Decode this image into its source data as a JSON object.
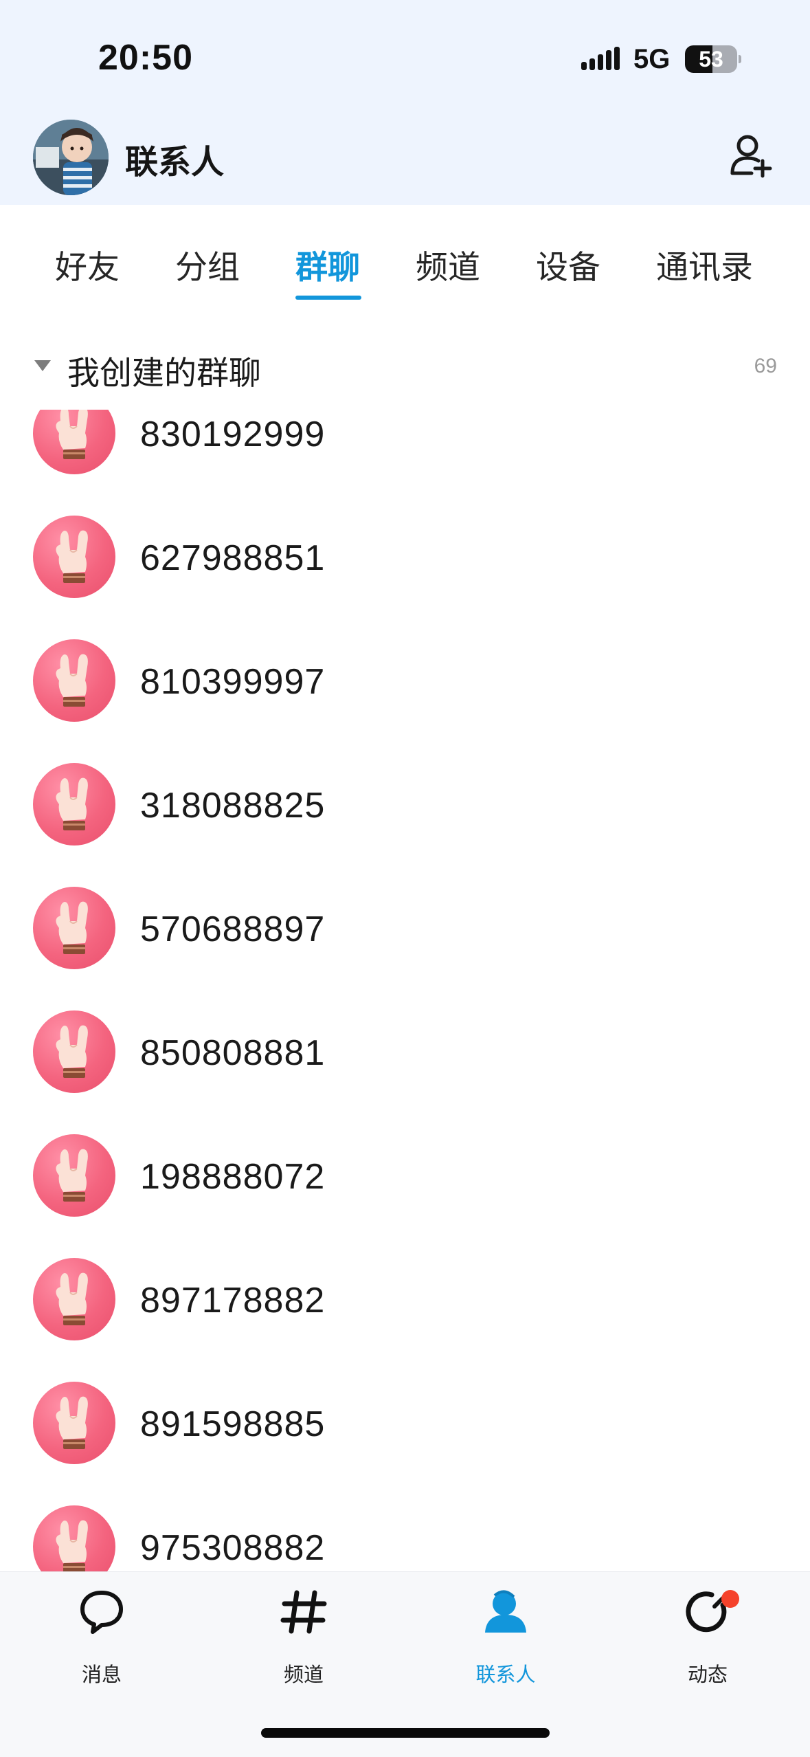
{
  "status_bar": {
    "time": "20:50",
    "network": "5G",
    "battery_level": "53",
    "battery_fraction": 0.53
  },
  "header": {
    "title": "联系人",
    "add_contact_icon": "person-add-icon",
    "avatar_icon": "user-avatar"
  },
  "tabs": [
    {
      "label": "好友"
    },
    {
      "label": "分组"
    },
    {
      "label": "群聊"
    },
    {
      "label": "频道"
    },
    {
      "label": "设备"
    },
    {
      "label": "通讯录"
    }
  ],
  "active_tab": "群聊",
  "section": {
    "title": "我创建的群聊",
    "count": "69",
    "caret_icon": "caret-down-icon"
  },
  "groups": [
    {
      "name": "830192999"
    },
    {
      "name": "627988851"
    },
    {
      "name": "810399997"
    },
    {
      "name": "318088825"
    },
    {
      "name": "570688897"
    },
    {
      "name": "850808881"
    },
    {
      "name": "198888072"
    },
    {
      "name": "897178882"
    },
    {
      "name": "891598885"
    },
    {
      "name": "975308882"
    }
  ],
  "bottom_nav": [
    {
      "label": "消息",
      "icon": "message-bubble-icon"
    },
    {
      "label": "频道",
      "icon": "hash-icon"
    },
    {
      "label": "联系人",
      "icon": "contacts-person-icon"
    },
    {
      "label": "动态",
      "icon": "dynamic-refresh-icon"
    }
  ],
  "colors": {
    "accent": "#1296db",
    "header_bg": "#eef4fe",
    "group_avatar": "#f4647f",
    "badge": "#f5422b"
  }
}
